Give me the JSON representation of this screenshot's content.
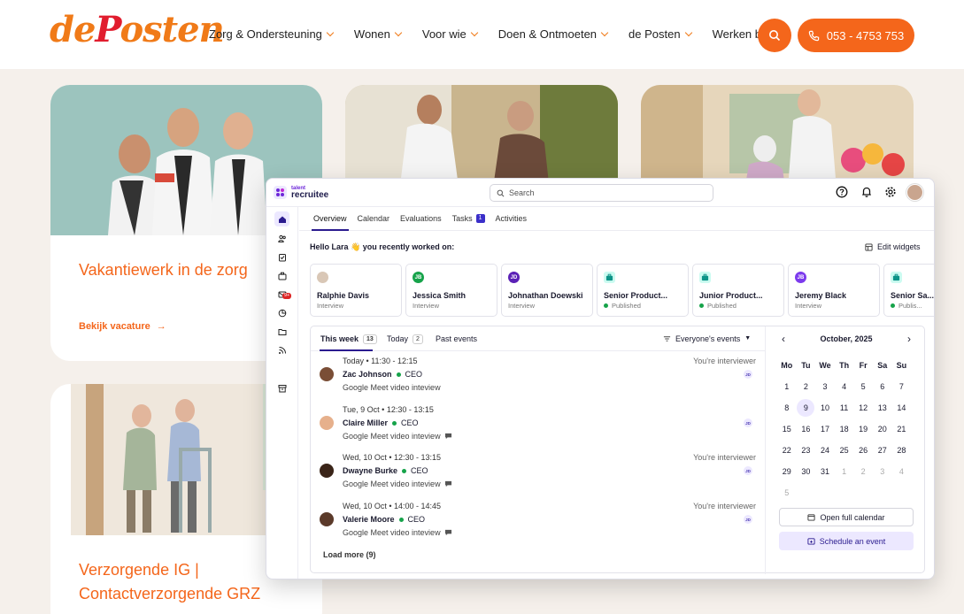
{
  "site": {
    "logo": {
      "pre": "de",
      "heart": "P",
      "post": "osten"
    },
    "nav": [
      "Zorg & Ondersteuning",
      "Wonen",
      "Voor wie",
      "Doen & Ontmoeten",
      "de Posten",
      "Werken bij"
    ],
    "phone": "053 - 4753 753",
    "cards": [
      {
        "title": "Vakantiewerk in de zorg",
        "link": "Bekijk vacature"
      },
      {
        "title": "Verzorgende IG | Contactverzorgende GRZ"
      }
    ],
    "colors": {
      "accent": "#f4661b",
      "bg": "#f5f0eb"
    }
  },
  "app": {
    "brand_top": "talent",
    "brand": "recruitee",
    "search_placeholder": "Search",
    "tabs": [
      {
        "label": "Overview"
      },
      {
        "label": "Calendar"
      },
      {
        "label": "Evaluations"
      },
      {
        "label": "Tasks",
        "badge": "1"
      },
      {
        "label": "Activities"
      }
    ],
    "sidebar_badge": "9+",
    "hello": "Hello Lara 👋 you recently worked on:",
    "edit_widgets": "Edit widgets",
    "recent": [
      {
        "name": "Ralphie Davis",
        "sub": "Interview",
        "initials": "",
        "color": "#d9c7b6",
        "kind": "photo"
      },
      {
        "name": "Jessica Smith",
        "sub": "Interview",
        "initials": "JB",
        "color": "#16a34a",
        "kind": "initials"
      },
      {
        "name": "Johnathan Doewski",
        "sub": "Interview",
        "initials": "JD",
        "color": "#5b21b6",
        "kind": "initials"
      },
      {
        "name": "Senior Product...",
        "sub": "Published",
        "initials": "",
        "color": "#14b8a6",
        "kind": "job"
      },
      {
        "name": "Junior Product...",
        "sub": "Published",
        "initials": "",
        "color": "#14b8a6",
        "kind": "job"
      },
      {
        "name": "Jeremy Black",
        "sub": "Interview",
        "initials": "JB",
        "color": "#7c3aed",
        "kind": "initials"
      },
      {
        "name": "Senior Sa...",
        "sub": "Publis...",
        "initials": "",
        "color": "#14b8a6",
        "kind": "job"
      }
    ],
    "events_tabs": {
      "week": "This week",
      "week_count": "13",
      "today": "Today",
      "today_count": "2",
      "past": "Past events",
      "filter": "Everyone's events"
    },
    "events": [
      {
        "date": "Today • 11:30 - 12:15",
        "name": "Zac Johnson",
        "role": "CEO",
        "meet": "Google Meet video inteview",
        "note": "You're interviewer",
        "initials": "JD",
        "chat": false
      },
      {
        "date": "Tue, 9 Oct • 12:30 - 13:15",
        "name": "Claire Miller",
        "role": "CEO",
        "meet": "Google Meet video inteview",
        "note": "",
        "initials": "JD",
        "chat": true
      },
      {
        "date": "Wed, 10 Oct • 12:30 - 13:15",
        "name": "Dwayne Burke",
        "role": "CEO",
        "meet": "Google Meet video inteview",
        "note": "You're interviewer",
        "initials": "JD",
        "chat": true
      },
      {
        "date": "Wed, 10 Oct • 14:00 - 14:45",
        "name": "Valerie Moore",
        "role": "CEO",
        "meet": "Google Meet video inteview",
        "note": "You're interviewer",
        "initials": "JD",
        "chat": true
      }
    ],
    "load_more": "Load more (9)",
    "calendar": {
      "month": "October, 2025",
      "weekdays": [
        "Mo",
        "Tu",
        "We",
        "Th",
        "Fr",
        "Sa",
        "Su"
      ],
      "days": [
        "1",
        "2",
        "3",
        "4",
        "5",
        "6",
        "7",
        "8",
        "9",
        "10",
        "11",
        "12",
        "13",
        "14",
        "15",
        "16",
        "17",
        "18",
        "19",
        "20",
        "21",
        "22",
        "23",
        "24",
        "25",
        "26",
        "27",
        "28",
        "29",
        "30",
        "31",
        "1",
        "2",
        "3",
        "4",
        "5"
      ],
      "selected": "9",
      "open_full": "Open full calendar",
      "schedule": "Schedule an event"
    }
  }
}
